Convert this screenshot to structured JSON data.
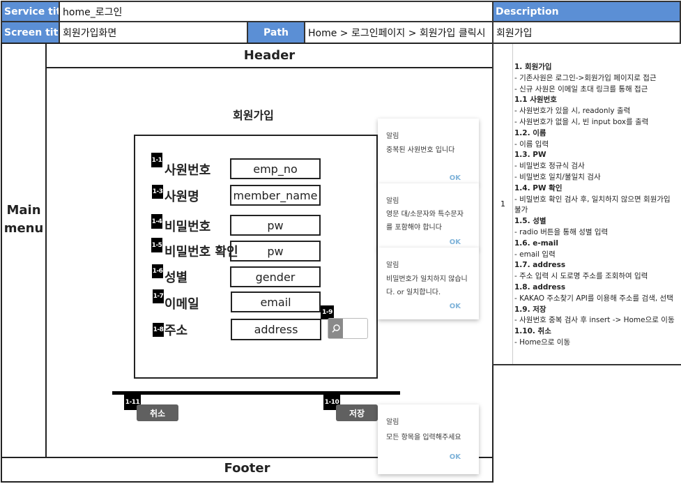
{
  "header_table": {
    "service_title_label": "Service title",
    "service_title_value": "home_로그인",
    "description_label": "Description",
    "screen_title_label": "Screen title",
    "screen_title_value": "회원가입화면",
    "path_label": "Path",
    "path_value": "Home > 로그인페이지 > 회원가입 클릭시",
    "description_value": "회원가입"
  },
  "layout": {
    "header": "Header",
    "main_menu": "Main\nmenu",
    "footer": "Footer"
  },
  "form": {
    "title": "회원가입",
    "fields": [
      {
        "tag": "1-1",
        "label": "사원번호",
        "value": "emp_no"
      },
      {
        "tag": "1-3",
        "label": "사원명",
        "value": "member_name"
      },
      {
        "tag": "1-4",
        "label": "비밀번호",
        "value": "pw"
      },
      {
        "tag": "1-5",
        "label": "비밀번호 확인",
        "value": "pw"
      },
      {
        "tag": "1-6",
        "label": "성별",
        "value": "gender"
      },
      {
        "tag": "1-7",
        "label": "이메일",
        "value": "email"
      },
      {
        "tag": "1-8",
        "label": "주소",
        "value": "address"
      }
    ],
    "search_tag": "1-9",
    "search_icon": "search-icon",
    "cancel_tag": "1-11",
    "cancel_label": "취소",
    "save_tag": "1-10",
    "save_label": "저장"
  },
  "alerts": [
    {
      "title": "알림",
      "lines": [
        "중복된 사원번호 입니다"
      ],
      "ok": "OK"
    },
    {
      "title": "알림",
      "lines": [
        "영문 대/소문자와 특수문자",
        "를 포함해야 합니다"
      ],
      "ok": "OK"
    },
    {
      "title": "알림",
      "lines": [
        "비밀번호가 일치하지 않습니",
        "다. or 일치합니다."
      ],
      "ok": "OK"
    },
    {
      "title": "알림",
      "lines": [
        "모든 항목을 입력해주세요"
      ],
      "ok": "OK"
    }
  ],
  "description": {
    "number": "1",
    "lines": [
      {
        "text": "1. 회원가입",
        "bold": true
      },
      {
        "text": "- 기존사원은 로그인->회원가입 페이지로 접근",
        "bold": false
      },
      {
        "text": "- 신규 사원은 이메일 초대 링크를 통해 접근",
        "bold": false
      },
      {
        "text": "1.1 사원번호",
        "bold": true
      },
      {
        "text": "- 사원번호가 있을 시, readonly 출력",
        "bold": false
      },
      {
        "text": "- 사원번호가 없을 시, 빈 input box를 출력",
        "bold": false
      },
      {
        "text": "1.2. 이름",
        "bold": true
      },
      {
        "text": "- 이름 입력",
        "bold": false
      },
      {
        "text": "1.3. PW",
        "bold": true
      },
      {
        "text": "- 비밀번호 정규식 검사",
        "bold": false
      },
      {
        "text": "- 비밀번호 일치/불일치 검사",
        "bold": false
      },
      {
        "text": "1.4. PW 확인",
        "bold": true
      },
      {
        "text": "- 비밀번호 확인 검사 후, 일치하지 않으면 회원가입",
        "bold": false
      },
      {
        "text": "불가",
        "bold": false
      },
      {
        "text": "1.5. 성별",
        "bold": true
      },
      {
        "text": "- radio 버튼을 통해 성별 입력",
        "bold": false
      },
      {
        "text": "1.6. e-mail",
        "bold": true
      },
      {
        "text": "- email 입력",
        "bold": false
      },
      {
        "text": "1.7. address",
        "bold": true
      },
      {
        "text": "- 주소 입력 시 도로명 주소를 조회하여 입력",
        "bold": false
      },
      {
        "text": "1.8. address",
        "bold": true
      },
      {
        "text": "- KAKAO 주소찾기 API를 이용해 주소를 검색, 선택",
        "bold": false
      },
      {
        "text": "1.9. 저장",
        "bold": true
      },
      {
        "text": "- 사원번호 중복 검사 후 insert -> Home으로 이동",
        "bold": false
      },
      {
        "text": "1.10. 취소",
        "bold": true
      },
      {
        "text": "- Home으로 이동",
        "bold": false
      }
    ]
  }
}
